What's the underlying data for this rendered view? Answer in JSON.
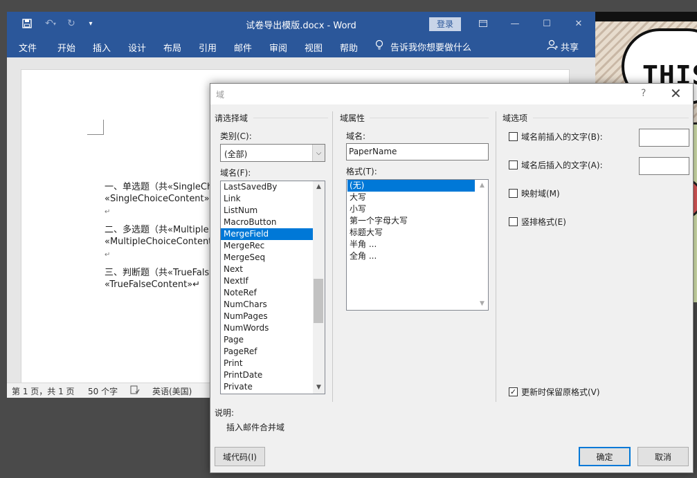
{
  "word": {
    "file_title": "试卷导出模版.docx",
    "separator": "-",
    "app_name": "Word",
    "login_label": "登录",
    "ribbon_tabs": [
      "文件",
      "开始",
      "插入",
      "设计",
      "布局",
      "引用",
      "邮件",
      "审阅",
      "视图",
      "帮助"
    ],
    "tell_me": "告诉我你想要做什么",
    "share_label": "共享",
    "doc_lines": [
      "一、单选题（共«SingleCh",
      "«SingleChoiceContent»↵",
      "↵",
      "二、多选题（共«Multiple",
      "«MultipleChoiceContent»",
      "↵",
      "三、判断题（共«TrueFals",
      "«TrueFalseContent»↵"
    ],
    "status": {
      "page": "第 1 页，共 1 页",
      "words": "50 个字",
      "language": "英语(美国)"
    }
  },
  "background_comic": {
    "bubble_text": "THIS"
  },
  "dialog": {
    "title": "域",
    "help": "?",
    "close": "✕",
    "choose_field": {
      "section_title": "请选择域",
      "category_label": "类别(C):",
      "category_value": "(全部)",
      "field_names_label": "域名(F):",
      "field_names": [
        "LastSavedBy",
        "Link",
        "ListNum",
        "MacroButton",
        "MergeField",
        "MergeRec",
        "MergeSeq",
        "Next",
        "NextIf",
        "NoteRef",
        "NumChars",
        "NumPages",
        "NumWords",
        "Page",
        "PageRef",
        "Print",
        "PrintDate",
        "Private"
      ],
      "selected_field": "MergeField"
    },
    "field_properties": {
      "section_title": "域属性",
      "field_name_label": "域名:",
      "field_name_value": "PaperName",
      "format_label": "格式(T):",
      "formats": [
        "(无)",
        "大写",
        "小写",
        "第一个字母大写",
        "标题大写",
        "半角 ...",
        "全角 ..."
      ],
      "selected_format": "(无)"
    },
    "field_options": {
      "section_title": "域选项",
      "text_before_label": "域名前插入的文字(B):",
      "text_after_label": "域名后插入的文字(A):",
      "mapped_label": "映射域(M)",
      "vertical_label": "竖排格式(E)",
      "preserve_label": "更新时保留原格式(V)",
      "preserve_checked": true
    },
    "description_label": "说明:",
    "description_text": "插入邮件合并域",
    "field_codes_button": "域代码(I)",
    "ok_button": "确定",
    "cancel_button": "取消"
  },
  "colors": {
    "word_blue": "#2b579a",
    "selection_blue": "#0078d7"
  }
}
